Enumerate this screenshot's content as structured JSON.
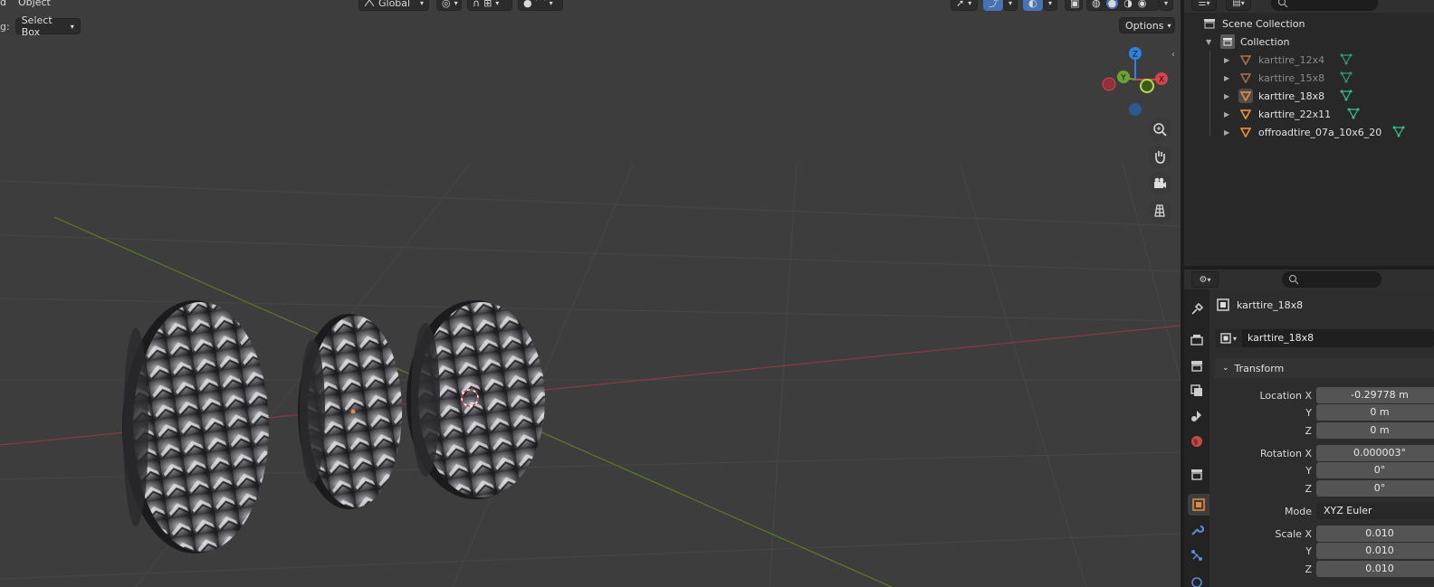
{
  "header": {
    "partial_left": "d",
    "object_menu": "Object",
    "transform_orientation": "Global"
  },
  "toolbar": {
    "drag_label_partial": "g:",
    "select_mode": "Select Box",
    "options_label": "Options"
  },
  "gizmo": {
    "z": "Z",
    "y": "Y",
    "x": "X",
    "z_color": "#2f83e0",
    "y_color": "#6ea232",
    "x_color": "#d9434e"
  },
  "outliner": {
    "scene_collection": "Scene Collection",
    "collection": "Collection",
    "items": [
      {
        "label": "karttire_12x4",
        "dimmed": true
      },
      {
        "label": "karttire_15x8",
        "dimmed": true
      },
      {
        "label": "karttire_18x8",
        "dimmed": false,
        "active": true
      },
      {
        "label": "karttire_22x11",
        "dimmed": false
      },
      {
        "label": "offroadtire_07a_10x6_20",
        "dimmed": false
      }
    ]
  },
  "properties": {
    "object_name": "karttire_18x8",
    "object_field": "karttire_18x8",
    "transform_panel": "Transform",
    "location_x_label": "Location X",
    "location_x": "-0.29778 m",
    "location_y_label": "Y",
    "location_y": "0 m",
    "location_z_label": "Z",
    "location_z": "0 m",
    "rotation_x_label": "Rotation X",
    "rotation_x": "0.000003°",
    "rotation_y_label": "Y",
    "rotation_y": "0°",
    "rotation_z_label": "Z",
    "rotation_z": "0°",
    "mode_label": "Mode",
    "mode_value": "XYZ Euler",
    "scale_x_label": "Scale X",
    "scale_x": "0.010",
    "scale_y_label": "Y",
    "scale_y": "0.010",
    "scale_z_label": "Z",
    "scale_z": "0.010"
  },
  "colors": {
    "accent_blue": "#4772b3",
    "object_orange": "#e3883c",
    "mesh_green": "#35c08a"
  }
}
